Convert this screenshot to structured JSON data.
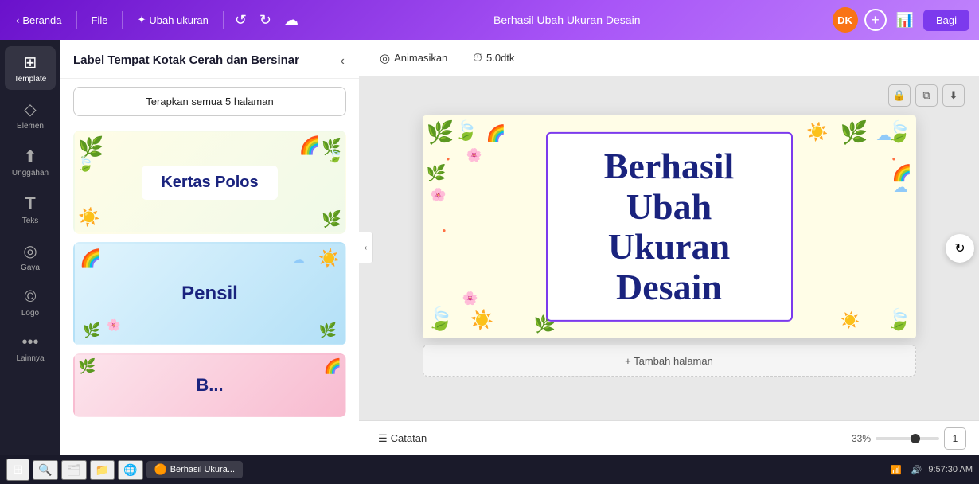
{
  "topnav": {
    "back_label": "Beranda",
    "file_label": "File",
    "resize_label": "Ubah ukuran",
    "title": "Berhasil Ubah Ukuran Desain",
    "avatar_text": "DK",
    "share_label": "Bagi",
    "add_icon": "+",
    "chart_icon": "📊"
  },
  "sidebar": {
    "items": [
      {
        "id": "template",
        "icon": "⊞",
        "label": "Template"
      },
      {
        "id": "elemen",
        "icon": "◇◆",
        "label": "Elemen"
      },
      {
        "id": "unggahan",
        "icon": "⬆",
        "label": "Unggahan"
      },
      {
        "id": "teks",
        "icon": "T",
        "label": "Teks"
      },
      {
        "id": "gaya",
        "icon": "◎",
        "label": "Gaya"
      },
      {
        "id": "logo",
        "icon": "©",
        "label": "Logo"
      },
      {
        "id": "lainnya",
        "icon": "···",
        "label": "Lainnya"
      }
    ]
  },
  "panel": {
    "title": "Label Tempat Kotak Cerah dan Bersinar",
    "apply_all": "Terapkan semua 5 halaman",
    "templates": [
      {
        "id": "t1",
        "label": "Kertas Polos",
        "bg": "cream"
      },
      {
        "id": "t2",
        "label": "Pensil",
        "bg": "blue"
      },
      {
        "id": "t3",
        "label": "B...",
        "bg": "pink"
      }
    ]
  },
  "canvas_toolbar": {
    "animate_label": "Animasikan",
    "duration_label": "5.0dtk"
  },
  "canvas": {
    "title_line1": "Berhasil Ubah",
    "title_line2": "Ukuran Desain"
  },
  "bottom": {
    "notes_label": "Catatan",
    "zoom_percent": "33%",
    "page_number": "1",
    "add_page_label": "+ Tambah halaman",
    "hide_icon": "▲"
  },
  "taskbar": {
    "start_icon": "⊞",
    "time": "9:57:30 AM",
    "app_label": "Berhasil Ukura...",
    "icons": [
      "🔍",
      "📁",
      "🌐",
      "🟠"
    ]
  }
}
